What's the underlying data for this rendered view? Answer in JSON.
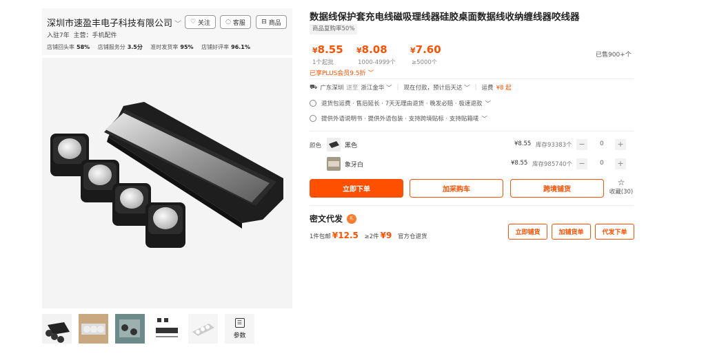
{
  "shop": {
    "name": "深圳市速盈丰电子科技有限公司",
    "years": "入驻7年",
    "main_business": "主营：手机配件",
    "stats": [
      {
        "label": "店铺回头率",
        "value": "58%"
      },
      {
        "label": "店铺服务分",
        "value": "3.5分"
      },
      {
        "label": "准时发货率",
        "value": "95%"
      },
      {
        "label": "店铺好评率",
        "value": "96.1%"
      }
    ],
    "follow_label": "关注",
    "service_label": "客服",
    "goods_label": "商品"
  },
  "gallery": {
    "params_label": "参数"
  },
  "product": {
    "title": "数据线保护套充电线磁吸理线器硅胶桌面数据线收纳缠线器咬线器",
    "repurchase": "商品复购率50%",
    "prices": [
      {
        "symbol": "¥",
        "value": "8.55",
        "tier": "1个起批"
      },
      {
        "symbol": "¥",
        "value": "8.08",
        "tier": "1000-4999个"
      },
      {
        "symbol": "¥",
        "value": "7.60",
        "tier": "≥5000个"
      }
    ],
    "sold": "已售900+个",
    "plus": "已享PLUS会员9.5折",
    "shipping": {
      "from": "广东深圳",
      "to_word": "送至",
      "dest": "浙江金华",
      "pay_note": "现在付款，预计后天达",
      "fee_label": "运费",
      "fee_value": "¥8 起"
    },
    "services": "退货包运费 · 售后延长 · 7天无理由退货 · 晚发必赔 · 极速退款",
    "cross": "提供外语说明书 · 提供外语包装 · 支持跨境贴标 · 支持贴箱唛",
    "color_label": "颜色",
    "variants": [
      {
        "name": "黑色",
        "price": "¥8.55",
        "stock": "库存93383个",
        "qty": "0",
        "swatch": "#3a3a3a"
      },
      {
        "name": "象牙白",
        "price": "¥8.55",
        "stock": "库存985740个",
        "qty": "0",
        "swatch": "#c9c3b6"
      }
    ],
    "buy_now": "立即下单",
    "add_cart": "加采购车",
    "cross_border": "跨境铺货",
    "favorite": "收藏(30)"
  },
  "dropship": {
    "title": "密文代发",
    "badge": "礼",
    "free1_label": "1件包邮",
    "free1_price": "¥12.5",
    "free2_label": "≥2件",
    "free2_price": "¥9",
    "warehouse": "官方仓退货",
    "btn_list": "立即铺货",
    "btn_add": "加铺货单",
    "btn_order": "代发下单"
  },
  "colors": {
    "accent": "#ff5000"
  }
}
